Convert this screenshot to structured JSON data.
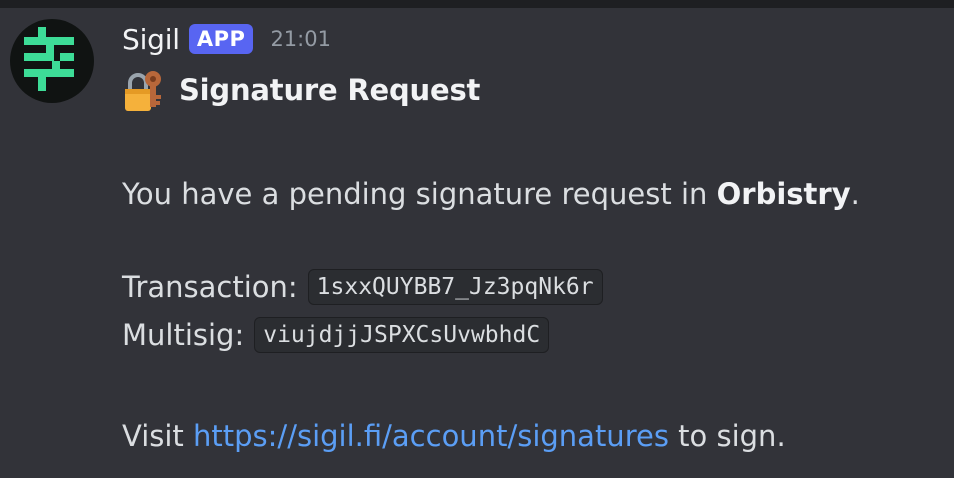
{
  "message": {
    "author": "Sigil",
    "badge": "APP",
    "timestamp": "21:01",
    "avatar_icon": "sigil-logo-icon",
    "title_icon": "closed-lock-with-key-icon",
    "title": "Signature Request",
    "intro_prefix": "You have a pending signature request in",
    "intro_org": "Orbistry",
    "intro_suffix": ".",
    "transaction_label": "Transaction:",
    "transaction_value": "1sxxQUYBB7_Jz3pqNk6r",
    "multisig_label": "Multisig:",
    "multisig_value": "viujdjjJSPXCsUvwbhdC",
    "visit_prefix": "Visit",
    "visit_link": "https://sigil.fi/account/signatures",
    "visit_suffix": "to sign."
  },
  "colors": {
    "background": "#323339",
    "badge": "#5865f2",
    "link": "#5b9ef5",
    "logo_green": "#3ddc97"
  }
}
